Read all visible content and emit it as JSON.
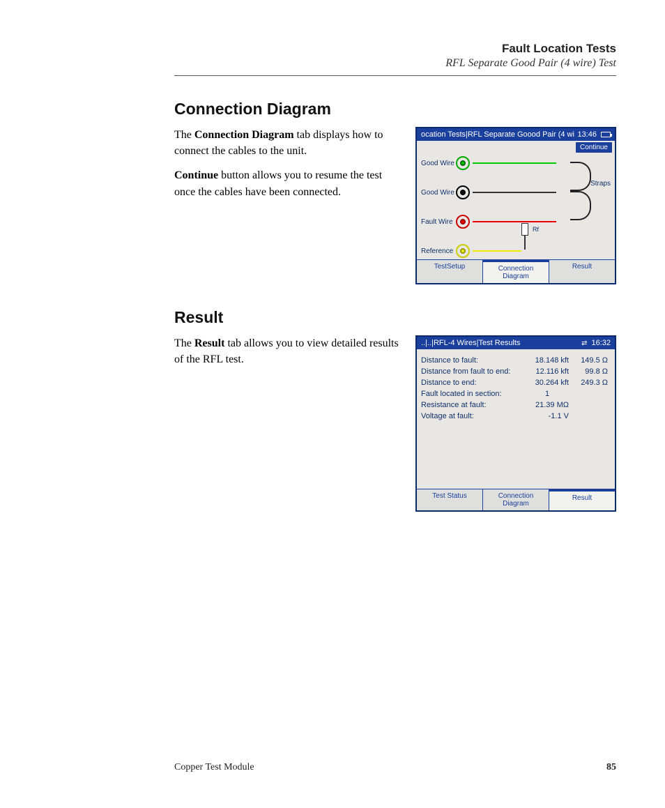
{
  "header": {
    "title": "Fault Location Tests",
    "subtitle": "RFL Separate Good Pair (4 wire) Test"
  },
  "section_cd": {
    "heading": "Connection Diagram",
    "p1a": "The ",
    "p1b": "Connection Diagram",
    "p1c": " tab displays how to connect the cables to the unit.",
    "p2a": "Continue",
    "p2b": " button allows you to resume the test once the cables have been connected."
  },
  "section_res": {
    "heading": "Result",
    "p1a": "The ",
    "p1b": "Result",
    "p1c": " tab allows you to view detailed results of the RFL test."
  },
  "device_cd": {
    "title": "ocation Tests|RFL Separate Goood Pair (4 wi",
    "time": "13:46",
    "continue": "Continue",
    "labels": {
      "good1": "Good Wire",
      "good2": "Good Wire",
      "fault": "Fault Wire",
      "ref": "Reference",
      "straps": "Straps",
      "rf": "Rf"
    },
    "tabs": {
      "t1": "TestSetup",
      "t2": "Connection Diagram",
      "t3": "Result"
    }
  },
  "device_res": {
    "title": "..|..|RFL-4 Wires|Test Results",
    "time": "16:32",
    "rows": [
      {
        "k": "Distance to fault:",
        "v1": "18.148 kft",
        "v2": "149.5 Ω"
      },
      {
        "k": "Distance from fault to end:",
        "v1": "12.116 kft",
        "v2": "99.8 Ω"
      },
      {
        "k": "Distance to end:",
        "v1": "30.264 kft",
        "v2": "249.3 Ω"
      },
      {
        "k": "Fault located in section:",
        "v1": "1",
        "v2": ""
      },
      {
        "k": "Resistance at fault:",
        "v1": "21.39 MΩ",
        "v2": ""
      },
      {
        "k": "Voltage at fault:",
        "v1": "-1.1 V",
        "v2": ""
      }
    ],
    "tabs": {
      "t1": "Test Status",
      "t2": "Connection Diagram",
      "t3": "Result"
    }
  },
  "footer": {
    "product": "Copper Test Module",
    "page": "85"
  }
}
